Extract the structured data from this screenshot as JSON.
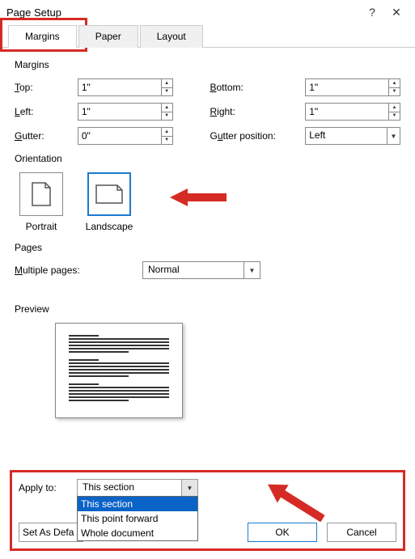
{
  "window": {
    "title": "Page Setup",
    "help": "?",
    "close": "✕"
  },
  "tabs": {
    "margins": "Margins",
    "paper": "Paper",
    "layout": "Layout"
  },
  "margins": {
    "section": "Margins",
    "top_label": "Top:",
    "top_value": "1\"",
    "bottom_label": "Bottom:",
    "bottom_value": "1\"",
    "left_label": "Left:",
    "left_value": "1\"",
    "right_label": "Right:",
    "right_value": "1\"",
    "gutter_label": "Gutter:",
    "gutter_value": "0\"",
    "gutter_pos_label": "Gutter position:",
    "gutter_pos_value": "Left"
  },
  "orientation": {
    "section": "Orientation",
    "portrait": "Portrait",
    "landscape": "Landscape"
  },
  "pages": {
    "section": "Pages",
    "multi_label": "Multiple pages:",
    "multi_value": "Normal"
  },
  "preview": {
    "section": "Preview"
  },
  "apply": {
    "label": "Apply to:",
    "value": "This section",
    "options": [
      "This section",
      "This point forward",
      "Whole document"
    ]
  },
  "footer": {
    "set_default": "Set As Default…",
    "set_default_clipped": "Set As Defa",
    "ok": "OK",
    "cancel": "Cancel"
  }
}
